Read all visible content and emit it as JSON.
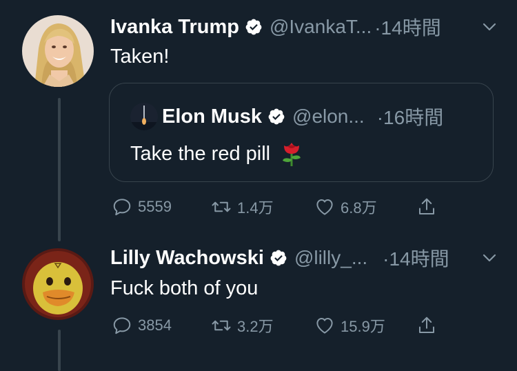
{
  "tweets": [
    {
      "name": "Ivanka Trump",
      "handle": "@IvankaT...",
      "time": "·14時間",
      "text": "Taken!",
      "quote": {
        "name": "Elon Musk",
        "handle": "@elon...",
        "time": "·16時間",
        "text": "Take the red pill"
      },
      "stats": {
        "replies": "5559",
        "retweets": "1.4万",
        "likes": "6.8万"
      }
    },
    {
      "name": "Lilly Wachowski",
      "handle": "@lilly_...",
      "time": "·14時間",
      "text": "Fuck both of you",
      "stats": {
        "replies": "3854",
        "retweets": "3.2万",
        "likes": "15.9万"
      }
    }
  ],
  "colors": {
    "background": "#15202b",
    "text": "#ffffff",
    "muted": "#8899a6",
    "border": "#38444d"
  },
  "icons": [
    "verified-badge-icon",
    "chevron-down-icon",
    "reply-icon",
    "retweet-icon",
    "like-icon",
    "share-icon",
    "rose-emoji-icon"
  ]
}
